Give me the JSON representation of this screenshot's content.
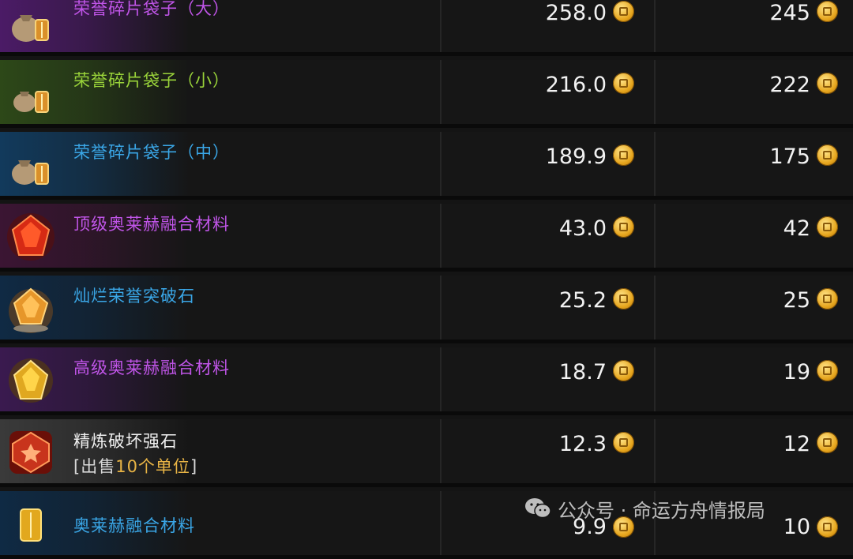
{
  "items": [
    {
      "name": "荣誉碎片袋子（大）",
      "color": "#c055e8",
      "bg": "#4b1b66",
      "icon": "bag-icon",
      "price1": "258.0",
      "price2": "245"
    },
    {
      "name": "荣誉碎片袋子（小）",
      "color": "#9ad43a",
      "bg": "#2d4818",
      "icon": "bag-icon",
      "price1": "216.0",
      "price2": "222"
    },
    {
      "name": "荣誉碎片袋子（中）",
      "color": "#3aa6e6",
      "bg": "#123a5c",
      "icon": "bag-icon",
      "price1": "189.9",
      "price2": "175"
    },
    {
      "name": "顶级奥莱赫融合材料",
      "color": "#c055e8",
      "bg": "#3b1533",
      "icon": "red-crystal-icon",
      "price1": "43.0",
      "price2": "42"
    },
    {
      "name": "灿烂荣誉突破石",
      "color": "#3aa6e6",
      "bg": "#102a44",
      "icon": "gold-gem-icon",
      "price1": "25.2",
      "price2": "25"
    },
    {
      "name": "高级奥莱赫融合材料",
      "color": "#c055e8",
      "bg": "#3a1a4f",
      "icon": "yellow-crystal-icon",
      "price1": "18.7",
      "price2": "19"
    },
    {
      "name": "精炼破坏强石",
      "color": "#f0f0f0",
      "bg": "#3a3a3a",
      "icon": "red-stone-icon",
      "sub_prefix": "[出售",
      "sub_highlight": "10个单位",
      "sub_suffix": "]",
      "price1": "12.3",
      "price2": "12"
    },
    {
      "name": "奥莱赫融合材料",
      "color": "#3aa6e6",
      "bg": "#0f2a44",
      "icon": "gold-bar-icon",
      "price1": "9.9",
      "price2": "10"
    }
  ],
  "watermark": {
    "text": "公众号 · 命运方舟情报局",
    "icon": "wechat-icon"
  }
}
